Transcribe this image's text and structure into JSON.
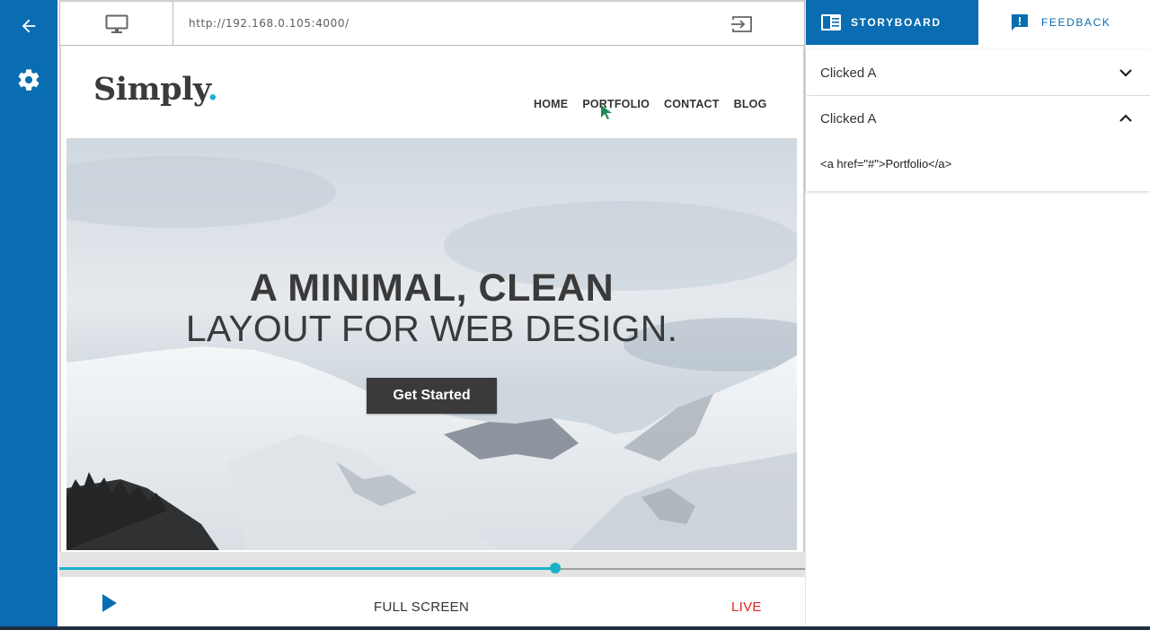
{
  "rail": {
    "back_icon": "arrow-left-icon",
    "settings_icon": "gear-icon"
  },
  "browser": {
    "device_icon": "monitor-icon",
    "url": "http://192.168.0.105:4000/",
    "exit_icon": "exit-icon"
  },
  "site": {
    "logo_text": "Simply",
    "logo_dot": ".",
    "nav": [
      "HOME",
      "PORTFOLIO",
      "CONTACT",
      "BLOG"
    ],
    "hero": {
      "heading_line1": "A MINIMAL, CLEAN",
      "heading_line2": "LAYOUT FOR WEB DESIGN.",
      "cta_label": "Get Started"
    }
  },
  "timeline": {
    "progress": 0.663
  },
  "controls": {
    "play_icon": "play-icon",
    "fullscreen_label": "FULL SCREEN",
    "live_label": "LIVE"
  },
  "panel": {
    "tabs": [
      {
        "label": "STORYBOARD",
        "icon": "storyboard-icon",
        "active": true
      },
      {
        "label": "FEEDBACK",
        "icon": "feedback-icon",
        "active": false
      }
    ],
    "events": [
      {
        "title": "Clicked A",
        "expanded": false
      },
      {
        "title": "Clicked A",
        "expanded": true,
        "detail": "<a href=\"#\">Portfolio</a>"
      }
    ]
  },
  "colors": {
    "primary": "#0a6db1",
    "accent": "#1bb1cb",
    "live": "#e0261e",
    "cursor": "#1f8a57"
  }
}
